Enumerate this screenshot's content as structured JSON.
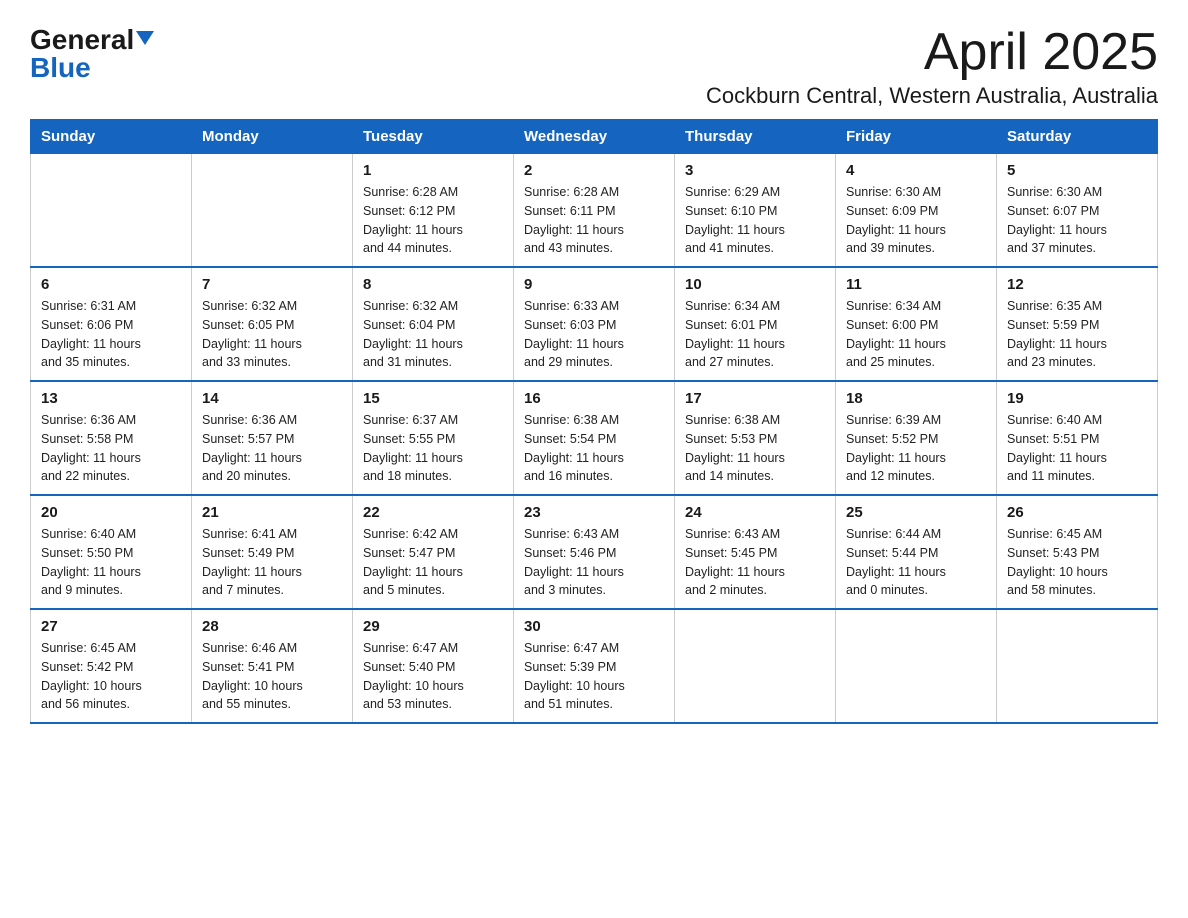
{
  "logo": {
    "general": "General",
    "blue": "Blue"
  },
  "title": "April 2025",
  "location": "Cockburn Central, Western Australia, Australia",
  "days_of_week": [
    "Sunday",
    "Monday",
    "Tuesday",
    "Wednesday",
    "Thursday",
    "Friday",
    "Saturday"
  ],
  "weeks": [
    [
      {
        "day": "",
        "info": ""
      },
      {
        "day": "",
        "info": ""
      },
      {
        "day": "1",
        "info": "Sunrise: 6:28 AM\nSunset: 6:12 PM\nDaylight: 11 hours\nand 44 minutes."
      },
      {
        "day": "2",
        "info": "Sunrise: 6:28 AM\nSunset: 6:11 PM\nDaylight: 11 hours\nand 43 minutes."
      },
      {
        "day": "3",
        "info": "Sunrise: 6:29 AM\nSunset: 6:10 PM\nDaylight: 11 hours\nand 41 minutes."
      },
      {
        "day": "4",
        "info": "Sunrise: 6:30 AM\nSunset: 6:09 PM\nDaylight: 11 hours\nand 39 minutes."
      },
      {
        "day": "5",
        "info": "Sunrise: 6:30 AM\nSunset: 6:07 PM\nDaylight: 11 hours\nand 37 minutes."
      }
    ],
    [
      {
        "day": "6",
        "info": "Sunrise: 6:31 AM\nSunset: 6:06 PM\nDaylight: 11 hours\nand 35 minutes."
      },
      {
        "day": "7",
        "info": "Sunrise: 6:32 AM\nSunset: 6:05 PM\nDaylight: 11 hours\nand 33 minutes."
      },
      {
        "day": "8",
        "info": "Sunrise: 6:32 AM\nSunset: 6:04 PM\nDaylight: 11 hours\nand 31 minutes."
      },
      {
        "day": "9",
        "info": "Sunrise: 6:33 AM\nSunset: 6:03 PM\nDaylight: 11 hours\nand 29 minutes."
      },
      {
        "day": "10",
        "info": "Sunrise: 6:34 AM\nSunset: 6:01 PM\nDaylight: 11 hours\nand 27 minutes."
      },
      {
        "day": "11",
        "info": "Sunrise: 6:34 AM\nSunset: 6:00 PM\nDaylight: 11 hours\nand 25 minutes."
      },
      {
        "day": "12",
        "info": "Sunrise: 6:35 AM\nSunset: 5:59 PM\nDaylight: 11 hours\nand 23 minutes."
      }
    ],
    [
      {
        "day": "13",
        "info": "Sunrise: 6:36 AM\nSunset: 5:58 PM\nDaylight: 11 hours\nand 22 minutes."
      },
      {
        "day": "14",
        "info": "Sunrise: 6:36 AM\nSunset: 5:57 PM\nDaylight: 11 hours\nand 20 minutes."
      },
      {
        "day": "15",
        "info": "Sunrise: 6:37 AM\nSunset: 5:55 PM\nDaylight: 11 hours\nand 18 minutes."
      },
      {
        "day": "16",
        "info": "Sunrise: 6:38 AM\nSunset: 5:54 PM\nDaylight: 11 hours\nand 16 minutes."
      },
      {
        "day": "17",
        "info": "Sunrise: 6:38 AM\nSunset: 5:53 PM\nDaylight: 11 hours\nand 14 minutes."
      },
      {
        "day": "18",
        "info": "Sunrise: 6:39 AM\nSunset: 5:52 PM\nDaylight: 11 hours\nand 12 minutes."
      },
      {
        "day": "19",
        "info": "Sunrise: 6:40 AM\nSunset: 5:51 PM\nDaylight: 11 hours\nand 11 minutes."
      }
    ],
    [
      {
        "day": "20",
        "info": "Sunrise: 6:40 AM\nSunset: 5:50 PM\nDaylight: 11 hours\nand 9 minutes."
      },
      {
        "day": "21",
        "info": "Sunrise: 6:41 AM\nSunset: 5:49 PM\nDaylight: 11 hours\nand 7 minutes."
      },
      {
        "day": "22",
        "info": "Sunrise: 6:42 AM\nSunset: 5:47 PM\nDaylight: 11 hours\nand 5 minutes."
      },
      {
        "day": "23",
        "info": "Sunrise: 6:43 AM\nSunset: 5:46 PM\nDaylight: 11 hours\nand 3 minutes."
      },
      {
        "day": "24",
        "info": "Sunrise: 6:43 AM\nSunset: 5:45 PM\nDaylight: 11 hours\nand 2 minutes."
      },
      {
        "day": "25",
        "info": "Sunrise: 6:44 AM\nSunset: 5:44 PM\nDaylight: 11 hours\nand 0 minutes."
      },
      {
        "day": "26",
        "info": "Sunrise: 6:45 AM\nSunset: 5:43 PM\nDaylight: 10 hours\nand 58 minutes."
      }
    ],
    [
      {
        "day": "27",
        "info": "Sunrise: 6:45 AM\nSunset: 5:42 PM\nDaylight: 10 hours\nand 56 minutes."
      },
      {
        "day": "28",
        "info": "Sunrise: 6:46 AM\nSunset: 5:41 PM\nDaylight: 10 hours\nand 55 minutes."
      },
      {
        "day": "29",
        "info": "Sunrise: 6:47 AM\nSunset: 5:40 PM\nDaylight: 10 hours\nand 53 minutes."
      },
      {
        "day": "30",
        "info": "Sunrise: 6:47 AM\nSunset: 5:39 PM\nDaylight: 10 hours\nand 51 minutes."
      },
      {
        "day": "",
        "info": ""
      },
      {
        "day": "",
        "info": ""
      },
      {
        "day": "",
        "info": ""
      }
    ]
  ]
}
